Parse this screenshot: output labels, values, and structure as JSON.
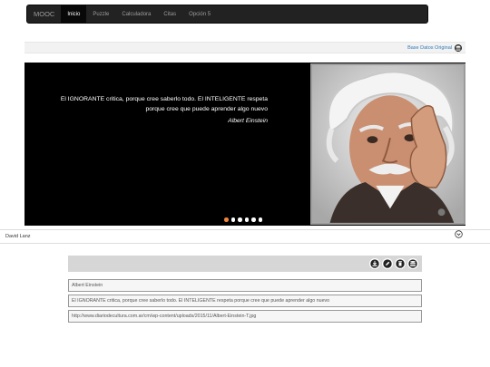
{
  "navbar": {
    "brand": "MOOC",
    "items": [
      {
        "label": "Inicio",
        "active": true
      },
      {
        "label": "Puzzle",
        "active": false
      },
      {
        "label": "Calculadora",
        "active": false
      },
      {
        "label": "Citas",
        "active": false
      },
      {
        "label": "Opción 5",
        "active": false
      }
    ]
  },
  "db_strip": {
    "link": "Base Datos Original",
    "icon": "database-icon"
  },
  "carousel": {
    "quote": "El IGNORANTE critica, porque cree saberlo todo. El INTELIGENTE respeta porque cree que puede aprender algo nuevo",
    "author": "Albert Einstein",
    "slide_count": 6,
    "active_slide": 1,
    "indicator_active_color": "#f0863c"
  },
  "author_bar": {
    "name": "David Lanz",
    "icon": "chevron-down-circle-icon"
  },
  "record": {
    "toolbar_icons": [
      "download-icon",
      "edit-icon",
      "trash-icon",
      "database-icon"
    ],
    "author": "Albert Einstein",
    "quote": "El IGNORANTE critica, porque cree saberlo todo. El INTELIGENTE respeta porque cree que puede aprender algo nuevo",
    "image_url": "http://www.diariodecultura.com.ar/cm/wp-content/uploads/2015/11/Albert-Einstein-T.jpg"
  }
}
